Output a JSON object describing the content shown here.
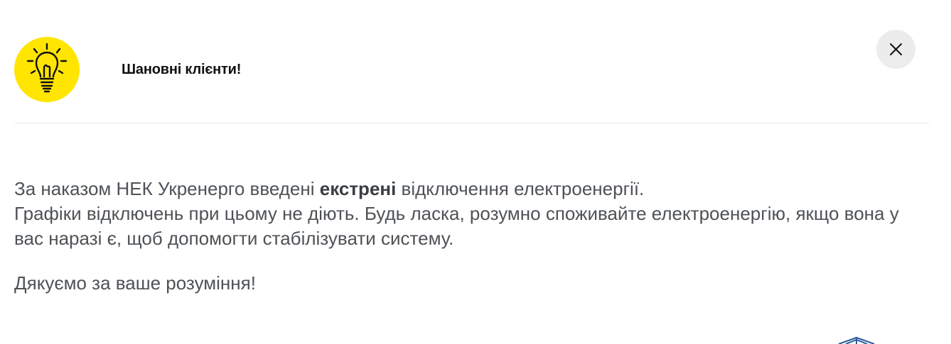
{
  "header": {
    "icon": "lightbulb-icon",
    "title": "Шановні клієнти!",
    "close_icon": "close-icon"
  },
  "message": {
    "line1_before": "За наказом НЕК Укренерго введені ",
    "line1_bold": "екстрені",
    "line1_after": " відключення електроенергії.",
    "paragraph2": "Графіки відключень при цьому не діють.  Будь ласка, розумно споживайте електроенергію, якщо вона у вас наразі є, щоб допомогти стабілізувати систему.",
    "thanks": "Дякуємо за ваше розуміння!"
  },
  "colors": {
    "badge_yellow": "#ffe500",
    "close_bg": "#ececec",
    "text_gray": "#4e5256",
    "logo_blue": "#2a5c9c"
  },
  "footer": {
    "logo_icon": "partial-logo-icon"
  }
}
